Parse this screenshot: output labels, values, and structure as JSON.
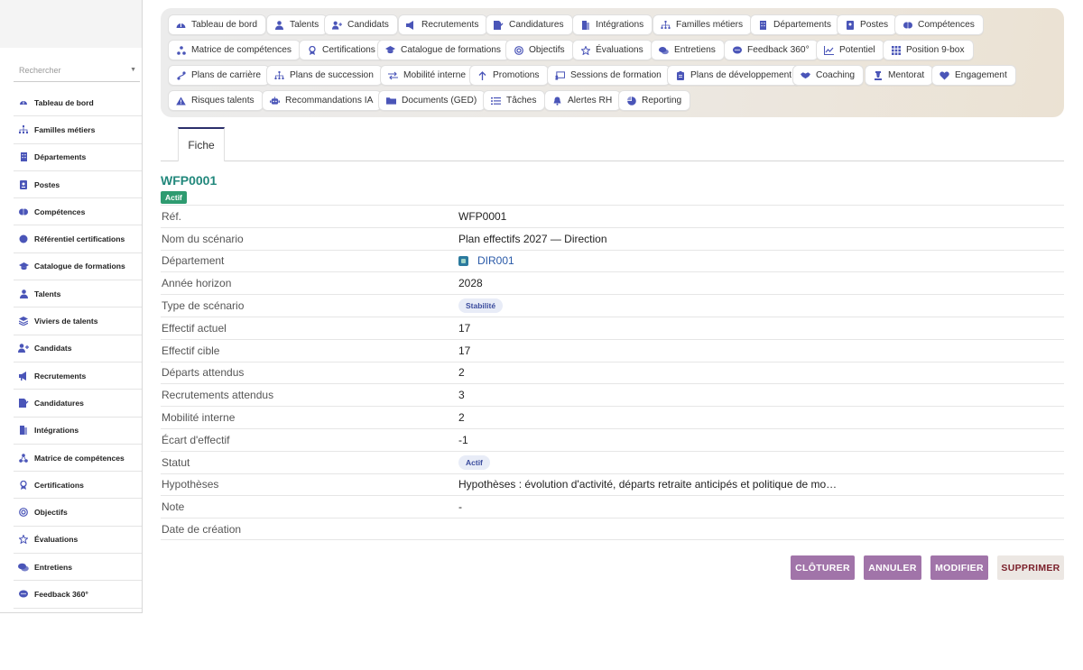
{
  "sidebar": {
    "search_placeholder": "Rechercher",
    "items": [
      {
        "label": "Tableau de bord",
        "icon": "dashboard-icon"
      },
      {
        "label": "Familles métiers",
        "icon": "sitemap-icon"
      },
      {
        "label": "Départements",
        "icon": "building-icon"
      },
      {
        "label": "Postes",
        "icon": "badge-icon"
      },
      {
        "label": "Compétences",
        "icon": "brain-icon"
      },
      {
        "label": "Référentiel certifications",
        "icon": "certificate-icon"
      },
      {
        "label": "Catalogue de formations",
        "icon": "graduation-cap-icon"
      },
      {
        "label": "Talents",
        "icon": "user-icon"
      },
      {
        "label": "Viviers de talents",
        "icon": "layers-icon"
      },
      {
        "label": "Candidats",
        "icon": "user-plus-icon"
      },
      {
        "label": "Recrutements",
        "icon": "megaphone-icon"
      },
      {
        "label": "Candidatures",
        "icon": "file-signature-icon"
      },
      {
        "label": "Intégrations",
        "icon": "door-icon"
      },
      {
        "label": "Matrice de compétences",
        "icon": "matrix-icon"
      },
      {
        "label": "Certifications",
        "icon": "award-icon"
      },
      {
        "label": "Objectifs",
        "icon": "target-icon"
      },
      {
        "label": "Évaluations",
        "icon": "star-icon"
      },
      {
        "label": "Entretiens",
        "icon": "comments-icon"
      },
      {
        "label": "Feedback 360°",
        "icon": "comment-dots-icon"
      }
    ]
  },
  "modules": [
    {
      "label": "Tableau de bord",
      "icon": "dashboard-icon"
    },
    {
      "label": "Talents",
      "icon": "user-icon"
    },
    {
      "label": "Candidats",
      "icon": "user-plus-icon"
    },
    {
      "label": "Recrutements",
      "icon": "megaphone-icon"
    },
    {
      "label": "Candidatures",
      "icon": "file-signature-icon"
    },
    {
      "label": "Intégrations",
      "icon": "door-icon"
    },
    {
      "label": "Familles métiers",
      "icon": "sitemap-icon"
    },
    {
      "label": "Départements",
      "icon": "building-icon"
    },
    {
      "label": "Postes",
      "icon": "badge-icon"
    },
    {
      "label": "Compétences",
      "icon": "brain-icon"
    },
    {
      "label": "Matrice de compétences",
      "icon": "matrix-icon"
    },
    {
      "label": "Certifications",
      "icon": "award-icon"
    },
    {
      "label": "Catalogue de formations",
      "icon": "graduation-cap-icon"
    },
    {
      "label": "Objectifs",
      "icon": "target-icon"
    },
    {
      "label": "Évaluations",
      "icon": "star-icon"
    },
    {
      "label": "Entretiens",
      "icon": "comments-icon"
    },
    {
      "label": "Feedback 360°",
      "icon": "comment-dots-icon"
    },
    {
      "label": "Potentiel",
      "icon": "chart-line-icon"
    },
    {
      "label": "Position 9-box",
      "icon": "grid-icon"
    },
    {
      "label": "Plans de carrière",
      "icon": "route-icon"
    },
    {
      "label": "Plans de succession",
      "icon": "sitemap-icon"
    },
    {
      "label": "Mobilité interne",
      "icon": "exchange-icon"
    },
    {
      "label": "Promotions",
      "icon": "arrow-up-icon"
    },
    {
      "label": "Sessions de formation",
      "icon": "chalkboard-icon"
    },
    {
      "label": "Plans de développement",
      "icon": "clipboard-icon"
    },
    {
      "label": "Coaching",
      "icon": "handshake-icon"
    },
    {
      "label": "Mentorat",
      "icon": "chess-icon"
    },
    {
      "label": "Engagement",
      "icon": "heart-icon"
    },
    {
      "label": "Risques talents",
      "icon": "warning-icon"
    },
    {
      "label": "Recommandations IA",
      "icon": "robot-icon"
    },
    {
      "label": "Documents (GED)",
      "icon": "folder-icon"
    },
    {
      "label": "Tâches",
      "icon": "tasks-icon"
    },
    {
      "label": "Alertes RH",
      "icon": "bell-icon"
    },
    {
      "label": "Reporting",
      "icon": "pie-chart-icon"
    }
  ],
  "tab": {
    "label": "Fiche"
  },
  "record": {
    "title": "WFP0001",
    "status_badge": "Actif",
    "fields": [
      {
        "key": "Réf.",
        "value": "WFP0001"
      },
      {
        "key": "Nom du scénario",
        "value": "Plan effectifs 2027 — Direction"
      },
      {
        "key": "Département",
        "value": "DIR001"
      },
      {
        "key": "Année horizon",
        "value": "2028"
      },
      {
        "key": "Type de scénario",
        "value": "Stabilité"
      },
      {
        "key": "Effectif actuel",
        "value": "17"
      },
      {
        "key": "Effectif cible",
        "value": "17"
      },
      {
        "key": "Départs attendus",
        "value": "2"
      },
      {
        "key": "Recrutements attendus",
        "value": "3"
      },
      {
        "key": "Mobilité interne",
        "value": "2"
      },
      {
        "key": "Écart d'effectif",
        "value": "-1"
      },
      {
        "key": "Statut",
        "value": "Actif"
      },
      {
        "key": "Hypothèses",
        "value": "Hypothèses : évolution d'activité, départs retraite anticipés et politique de mo…"
      },
      {
        "key": "Note",
        "value": "-"
      },
      {
        "key": "Date de création",
        "value": ""
      }
    ]
  },
  "actions": {
    "close": "CLÔTURER",
    "cancel": "ANNULER",
    "edit": "MODIFIER",
    "delete": "SUPPRIMER"
  },
  "colors": {
    "accent": "#4a55b8",
    "title": "#22887c",
    "badge_green": "#2e9b70",
    "button_purple": "#a174a9",
    "delete_text": "#7a1f2a"
  }
}
